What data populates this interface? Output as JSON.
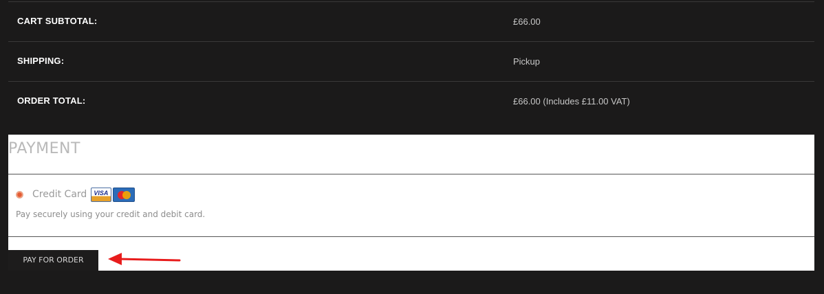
{
  "order_totals": [
    {
      "label": "CART SUBTOTAL:",
      "value": "£66.00"
    },
    {
      "label": "SHIPPING:",
      "value": "Pickup"
    },
    {
      "label": "ORDER TOTAL:",
      "value": "£66.00 (Includes £11.00 VAT)"
    }
  ],
  "payment": {
    "title": "PAYMENT",
    "method": {
      "label": "Credit Card",
      "selected": true,
      "icons": [
        "visa-card-icon",
        "mastercard-icon"
      ],
      "visa_text": "VISA",
      "description": "Pay securely using your credit and debit card."
    },
    "pay_button_label": "PAY FOR ORDER"
  },
  "colors": {
    "page_background": "#1b1a1a",
    "panel_background": "#ffffff",
    "radio_accent": "#e35b34",
    "annotation_arrow": "#e81c1c"
  }
}
